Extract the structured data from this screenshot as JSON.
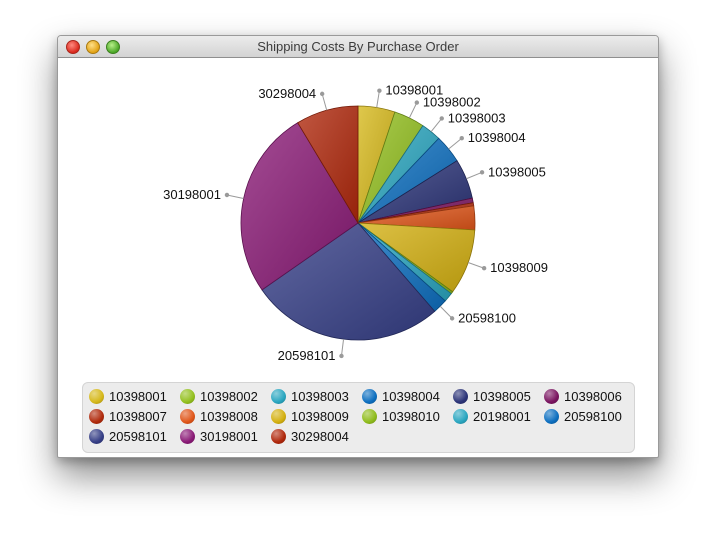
{
  "window": {
    "title": "Shipping Costs By Purchase Order"
  },
  "chart_data": {
    "type": "pie",
    "title": "",
    "start_angle_deg": 90,
    "direction": "clockwise",
    "series": [
      {
        "name": "10398001",
        "value": 4.8,
        "color": "#d6b81a",
        "labeled": true
      },
      {
        "name": "10398002",
        "value": 4.0,
        "color": "#93c01e",
        "labeled": true
      },
      {
        "name": "10398003",
        "value": 2.6,
        "color": "#2aa6c0",
        "labeled": true
      },
      {
        "name": "10398004",
        "value": 3.7,
        "color": "#0d6fc0",
        "labeled": true
      },
      {
        "name": "10398005",
        "value": 5.2,
        "color": "#2c3478",
        "labeled": true
      },
      {
        "name": "10398006",
        "value": 0.6,
        "color": "#7a1460",
        "labeled": false
      },
      {
        "name": "10398007",
        "value": 0.4,
        "color": "#b02a0c",
        "labeled": false
      },
      {
        "name": "10398008",
        "value": 3.1,
        "color": "#e0561a",
        "labeled": false
      },
      {
        "name": "10398009",
        "value": 8.5,
        "color": "#d4b010",
        "labeled": true
      },
      {
        "name": "10398010",
        "value": 0.3,
        "color": "#8fbc1c",
        "labeled": false
      },
      {
        "name": "20198001",
        "value": 1.2,
        "color": "#2aa6c0",
        "labeled": false
      },
      {
        "name": "20598100",
        "value": 1.9,
        "color": "#0d6fc0",
        "labeled": true
      },
      {
        "name": "20598101",
        "value": 25.1,
        "color": "#353e86",
        "labeled": true
      },
      {
        "name": "30198001",
        "value": 24.5,
        "color": "#8a1a76",
        "labeled": true
      },
      {
        "name": "30298004",
        "value": 8.1,
        "color": "#b0280c",
        "labeled": true
      }
    ]
  }
}
